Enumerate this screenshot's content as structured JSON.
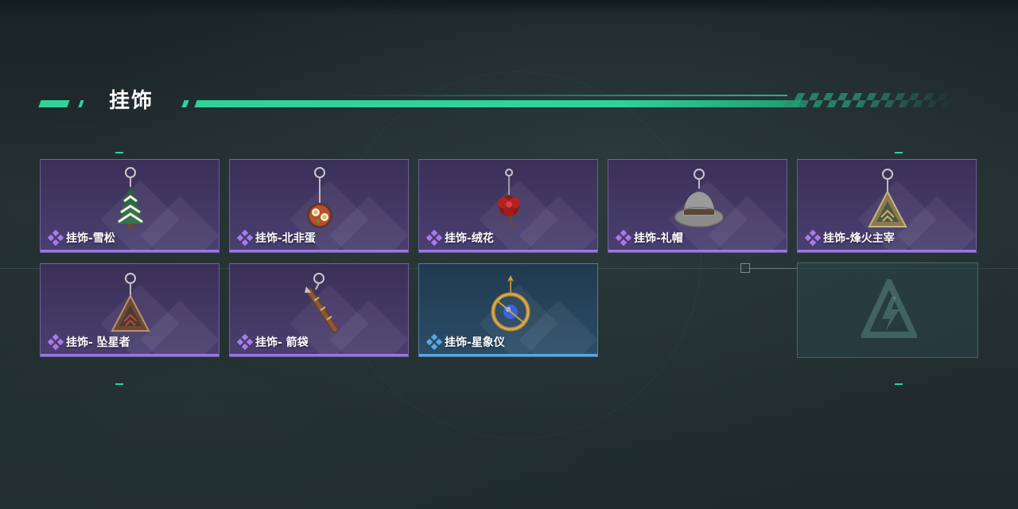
{
  "section": {
    "title": "挂饰"
  },
  "colors": {
    "accent_green": "#2fd39a",
    "rarity_purple": "#9b76e6",
    "rarity_blue": "#5aa6e6"
  },
  "items": [
    {
      "label": "挂饰-雪松",
      "rarity": "purple",
      "icon": "snow-tree-charm-icon"
    },
    {
      "label": "挂饰-北非蛋",
      "rarity": "purple",
      "icon": "shakshuka-charm-icon"
    },
    {
      "label": "挂饰-绒花",
      "rarity": "purple",
      "icon": "red-flower-charm-icon"
    },
    {
      "label": "挂饰-礼帽",
      "rarity": "purple",
      "icon": "fedora-hat-charm-icon"
    },
    {
      "label": "挂饰-烽火主宰",
      "rarity": "purple",
      "icon": "triangle-emblem-charm-icon"
    },
    {
      "label": "挂饰- 坠星者",
      "rarity": "purple",
      "icon": "star-faller-triangle-charm-icon"
    },
    {
      "label": "挂饰- 箭袋",
      "rarity": "purple",
      "icon": "quiver-charm-icon"
    },
    {
      "label": "挂饰-星象仪",
      "rarity": "blue",
      "icon": "astrolabe-charm-icon"
    }
  ],
  "empty_slot": {
    "icon": "game-logo-placeholder-icon"
  }
}
